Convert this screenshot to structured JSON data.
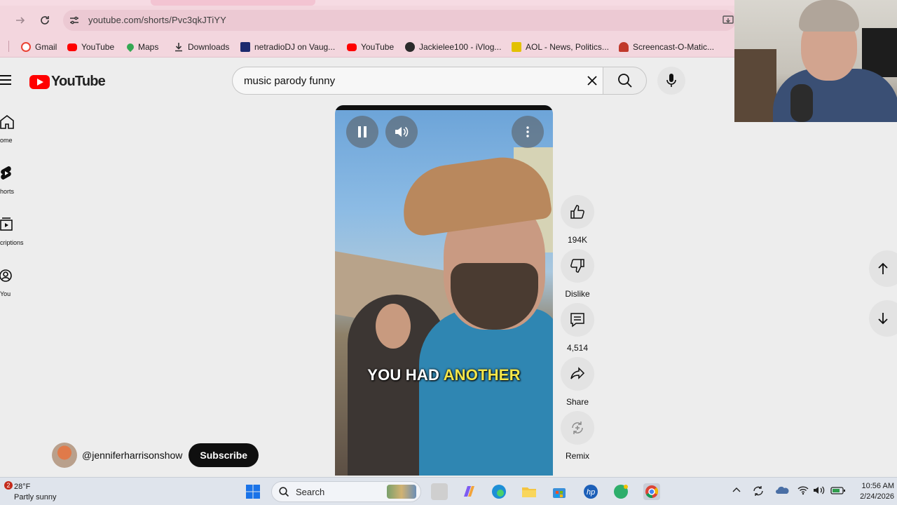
{
  "browser": {
    "url": "youtube.com/shorts/Pvc3qkJTiYY",
    "bookmarks": [
      {
        "label": "Gmail",
        "color": "#ea4335"
      },
      {
        "label": "YouTube",
        "color": "#ff0000"
      },
      {
        "label": "Maps",
        "color": "#34a853"
      },
      {
        "label": "Downloads",
        "color": "#444444"
      },
      {
        "label": "netradioDJ on Vaug...",
        "color": "#1c2a6e"
      },
      {
        "label": "YouTube",
        "color": "#ff0000"
      },
      {
        "label": "Jackielee100 - iVlog...",
        "color": "#2b2b2b"
      },
      {
        "label": "AOL - News, Politics...",
        "color": "#e2c100"
      },
      {
        "label": "Screencast-O-Matic...",
        "color": "#c0392b"
      }
    ]
  },
  "youtube": {
    "logo_text": "YouTube",
    "search_query": "music parody funny",
    "sidebar": [
      {
        "label": "ome"
      },
      {
        "label": "horts"
      },
      {
        "label": "criptions"
      },
      {
        "label": "You"
      }
    ],
    "video": {
      "caption_part1": "YOU HAD",
      "caption_highlight": "ANOTHER"
    },
    "actions": {
      "like_count": "194K",
      "dislike_label": "Dislike",
      "comment_count": "4,514",
      "share_label": "Share",
      "remix_label": "Remix"
    },
    "channel": {
      "handle": "@jenniferharrisonshow",
      "subscribe_label": "Subscribe"
    }
  },
  "taskbar": {
    "weather_badge": "2",
    "temperature": "28°F",
    "condition": "Partly sunny",
    "search_label": "Search",
    "time": "10:56 AM",
    "date": "2/24/2026"
  }
}
